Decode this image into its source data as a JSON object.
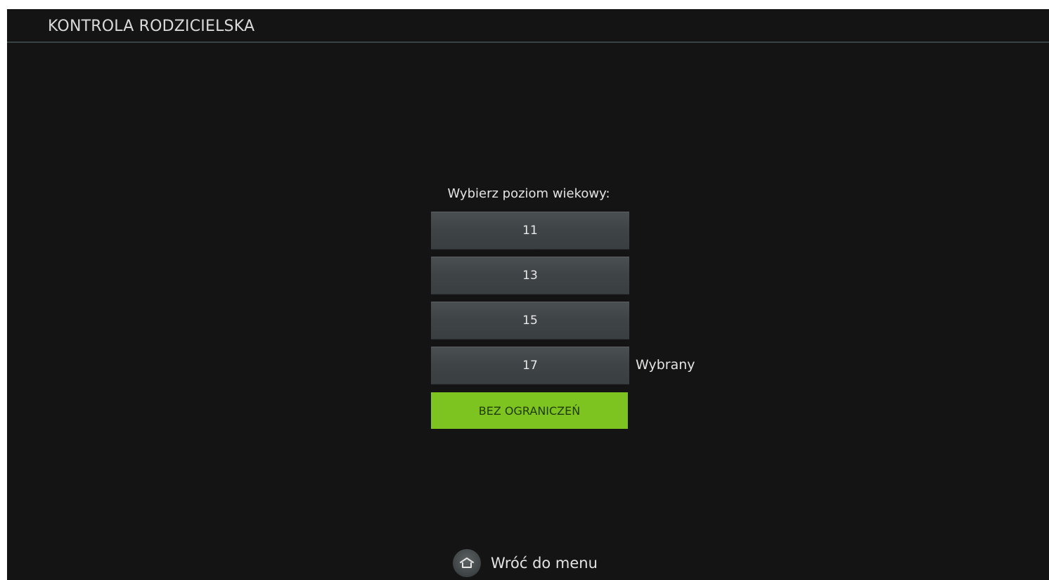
{
  "header": {
    "title": "KONTROLA RODZICIELSKA"
  },
  "main": {
    "prompt": "Wybierz poziom wiekowy:",
    "options": [
      {
        "label": "11"
      },
      {
        "label": "13"
      },
      {
        "label": "15"
      },
      {
        "label": "17"
      },
      {
        "label": "BEZ OGRANICZEŃ"
      }
    ],
    "selected_marker": "Wybrany",
    "highlight_color": "#7ec421"
  },
  "footer": {
    "back_icon": "home-icon",
    "back_label": "Wróć do menu"
  }
}
